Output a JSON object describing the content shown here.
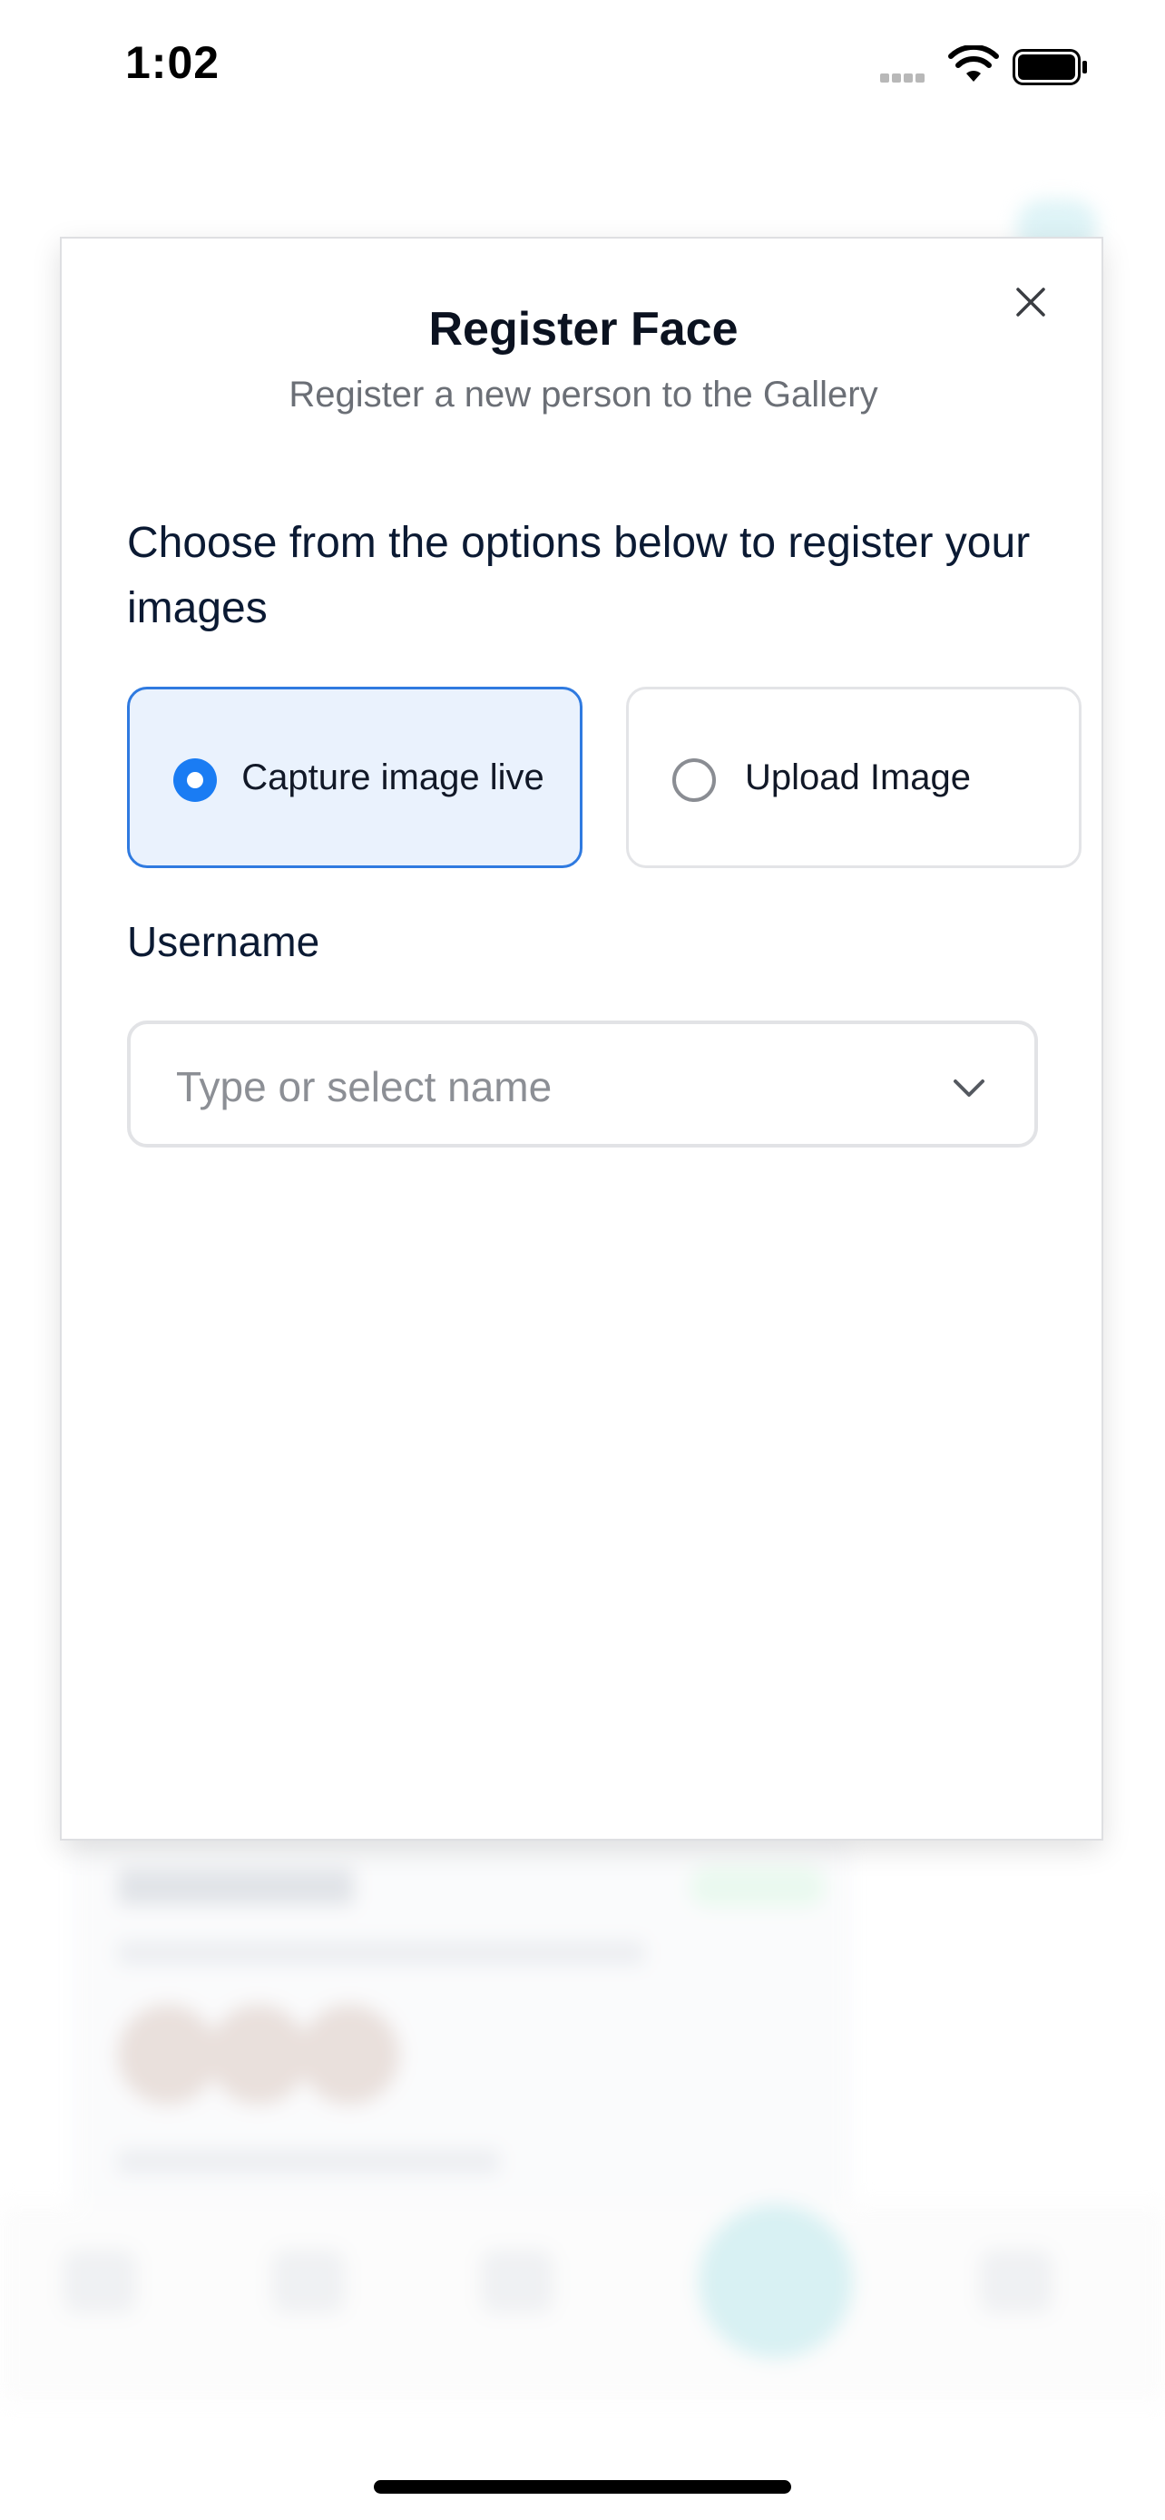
{
  "status_bar": {
    "time": "1:02"
  },
  "modal": {
    "title": "Register Face",
    "subtitle": "Register a new person to the Gallery",
    "instructions": "Choose from the options below to register your images",
    "options": [
      {
        "label": "Capture image live",
        "selected": true
      },
      {
        "label": "Upload Image",
        "selected": false
      }
    ],
    "username": {
      "label": "Username",
      "placeholder": "Type or select name"
    }
  },
  "colors": {
    "accent": "#1a7cf3",
    "selected_bg": "#eaf2fd",
    "selected_border": "#2f7ae0"
  },
  "icons": [
    "close-icon",
    "chevron-down-icon",
    "wifi-icon",
    "battery-icon",
    "signal-icon"
  ]
}
